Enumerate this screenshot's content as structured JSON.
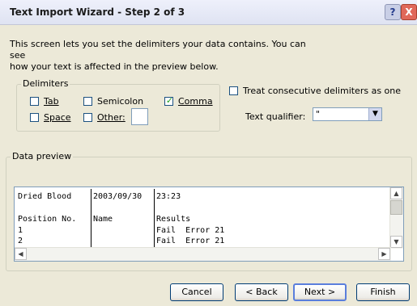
{
  "window": {
    "title": "Text Import Wizard - Step 2 of 3",
    "help_glyph": "?",
    "close_glyph": "X"
  },
  "intro": {
    "line1": "This screen lets you set the delimiters your data contains.  You can see",
    "line2": "how your text is affected in the preview below."
  },
  "delimiters": {
    "legend": "Delimiters",
    "tab": {
      "label": "Tab",
      "checked": false
    },
    "semicolon": {
      "label": "Semicolon",
      "checked": false
    },
    "comma": {
      "label": "Comma",
      "checked": true
    },
    "space": {
      "label": "Space",
      "checked": false
    },
    "other": {
      "label": "Other:",
      "checked": false,
      "value": ""
    }
  },
  "consecutive": {
    "label": "Treat consecutive delimiters as one",
    "checked": false
  },
  "qualifier": {
    "label": "Text qualifier:",
    "value": "\""
  },
  "preview": {
    "legend": "Data preview",
    "rows": [
      [
        "Dried Blood",
        "2003/09/30",
        "23:23"
      ],
      [
        "",
        "",
        ""
      ],
      [
        "Position No.",
        "Name",
        "Results"
      ],
      [
        "1",
        "",
        "Fail  Error 21"
      ],
      [
        "2",
        "",
        "Fail  Error 21"
      ]
    ]
  },
  "buttons": {
    "cancel": "Cancel",
    "back": "< Back",
    "next": "Next >",
    "finish": "Finish"
  },
  "glyphs": {
    "check": "✓",
    "up": "▲",
    "down": "▼",
    "left": "◀",
    "right": "▶"
  }
}
